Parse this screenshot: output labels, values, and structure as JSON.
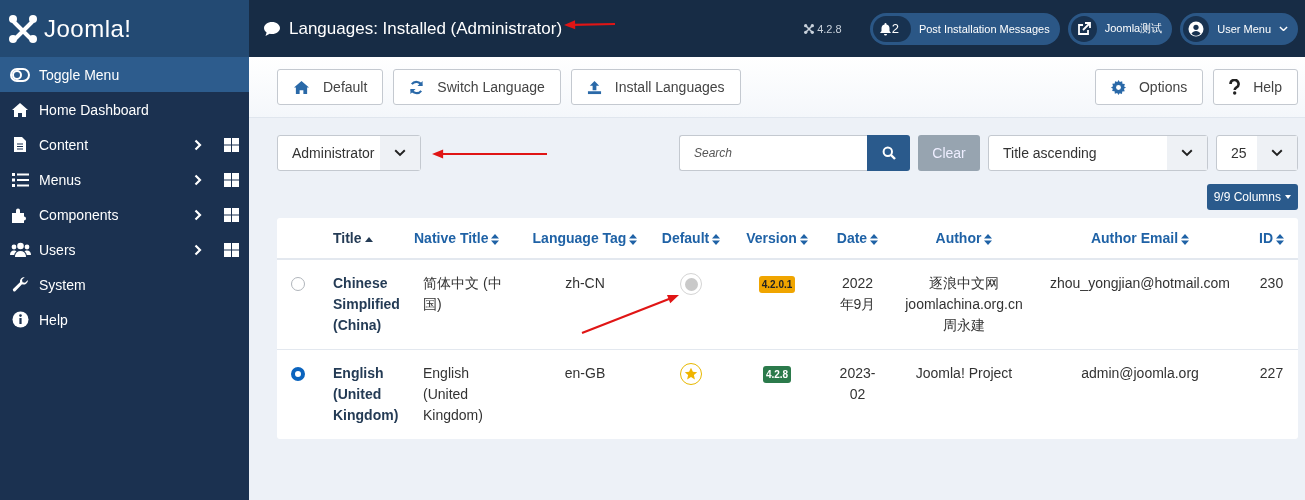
{
  "sidebar": {
    "logo_text": "Joomla!",
    "items": [
      {
        "label": "Toggle Menu",
        "selected": true,
        "expandable": false
      },
      {
        "label": "Home Dashboard",
        "selected": false,
        "expandable": false
      },
      {
        "label": "Content",
        "selected": false,
        "expandable": true
      },
      {
        "label": "Menus",
        "selected": false,
        "expandable": true
      },
      {
        "label": "Components",
        "selected": false,
        "expandable": true
      },
      {
        "label": "Users",
        "selected": false,
        "expandable": true
      },
      {
        "label": "System",
        "selected": false,
        "expandable": false
      },
      {
        "label": "Help",
        "selected": false,
        "expandable": false
      }
    ]
  },
  "header": {
    "title": "Languages: Installed (Administrator)",
    "version": "4.2.8",
    "buttons": [
      {
        "count": "2",
        "label": "Post Installation Messages"
      },
      {
        "label": "Joomla测试"
      },
      {
        "label": "User Menu"
      }
    ]
  },
  "toolbar": {
    "left": [
      "Default",
      "Switch Language",
      "Install Languages"
    ],
    "right": [
      "Options",
      "Help"
    ]
  },
  "filters": {
    "client": "Administrator",
    "search_placeholder": "Search",
    "clear": "Clear",
    "ordering": "Title ascending",
    "limit": "25",
    "columns": "9/9 Columns"
  },
  "table": {
    "columns": [
      {
        "label": "Title",
        "sorted": true
      },
      {
        "label": "Native Title",
        "sorted": false
      },
      {
        "label": "Language Tag",
        "sorted": false
      },
      {
        "label": "Default",
        "sorted": false
      },
      {
        "label": "Version",
        "sorted": false
      },
      {
        "label": "Date",
        "sorted": false
      },
      {
        "label": "Author",
        "sorted": false
      },
      {
        "label": "Author Email",
        "sorted": false
      },
      {
        "label": "ID",
        "sorted": false
      }
    ],
    "rows": [
      {
        "selected": false,
        "title": "Chinese Simplified (China)",
        "native_title": "简体中文 (中国)",
        "tag": "zh-CN",
        "default": false,
        "version": "4.2.0.1",
        "color": "#f0a500",
        "date": "2022年9月",
        "author": "逐浪中文网 joomlachina.org.cn 周永建",
        "email": "zhou_yongjian@hotmail.com",
        "id": "230"
      },
      {
        "selected": true,
        "title": "English (United Kingdom)",
        "native_title": "English (United Kingdom)",
        "tag": "en-GB",
        "default": true,
        "version": "4.2.8",
        "color": "#2b7a4b",
        "date": "2023-02",
        "author": "Joomla! Project",
        "email": "admin@joomla.org",
        "id": "227"
      }
    ]
  }
}
